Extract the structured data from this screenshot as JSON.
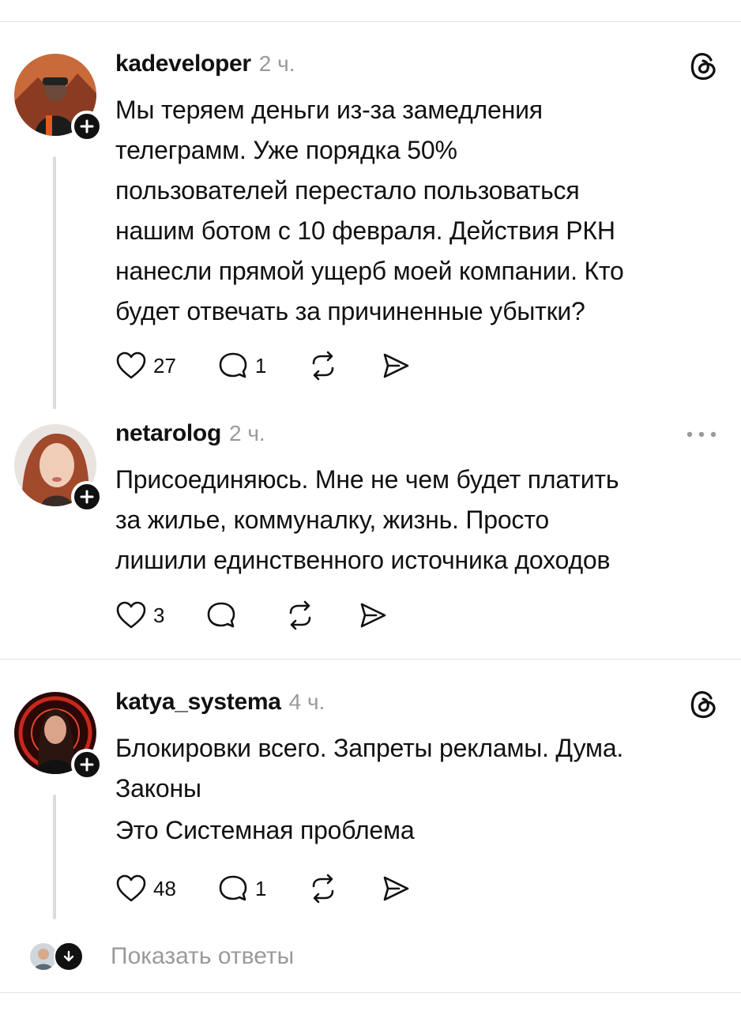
{
  "posts": [
    {
      "username": "kadeveloper",
      "time": "2 ч.",
      "corner_icon": "threads-logo-icon",
      "lines": [
        "Мы теряем деньги из-за замедления",
        "телеграмм. Уже порядка 50%",
        "пользователей перестало пользоваться",
        "нашим ботом с 10 февраля. Действия РКН",
        "нанесли прямой ущерб моей компании. Кто",
        "будет отвечать за причиненные убытки?"
      ],
      "likes": "27",
      "comments": "1"
    },
    {
      "username": "netarolog",
      "time": "2 ч.",
      "corner_icon": "more-options-icon",
      "lines": [
        "Присоединяюсь. Мне не чем будет платить",
        "за жилье, коммуналку, жизнь. Просто",
        "лишили единственного источника доходов"
      ],
      "likes": "3",
      "comments": ""
    },
    {
      "username": "katya_systema",
      "time": "4 ч.",
      "corner_icon": "threads-logo-icon",
      "paragraphs": [
        "Блокировки всего. Запреты рекламы. Дума.",
        "Законы",
        "Это Системная проблема"
      ],
      "likes": "48",
      "comments": "1"
    }
  ],
  "show_replies_label": "Показать ответы"
}
